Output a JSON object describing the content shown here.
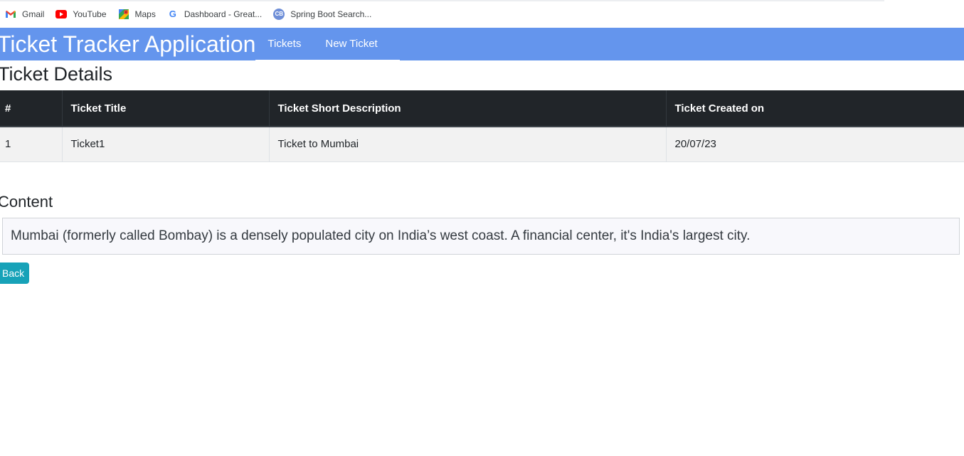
{
  "bookmarks": [
    {
      "label": "Gmail",
      "icon": "gmail-icon"
    },
    {
      "label": "YouTube",
      "icon": "youtube-icon"
    },
    {
      "label": "Maps",
      "icon": "maps-icon"
    },
    {
      "label": "Dashboard - Great...",
      "icon": "google-icon"
    },
    {
      "label": "Spring Boot Search...",
      "icon": "cb-icon",
      "icon_text": "CB"
    }
  ],
  "navbar": {
    "brand": "Ticket Tracker Application",
    "links": [
      "Tickets",
      "New Ticket"
    ],
    "color": "#6495ed"
  },
  "page": {
    "heading": "Ticket Details"
  },
  "table": {
    "headers": [
      "#",
      "Ticket Title",
      "Ticket Short Description",
      "Ticket Created on"
    ],
    "rows": [
      [
        "1",
        "Ticket1",
        "Ticket to Mumbai",
        "20/07/23"
      ]
    ]
  },
  "content": {
    "heading": "Content",
    "text": "Mumbai (formerly called Bombay) is a densely populated city on India’s west coast. A financial center, it's India's largest city."
  },
  "actions": {
    "back_label": "Back",
    "back_color": "#17a2b8"
  }
}
